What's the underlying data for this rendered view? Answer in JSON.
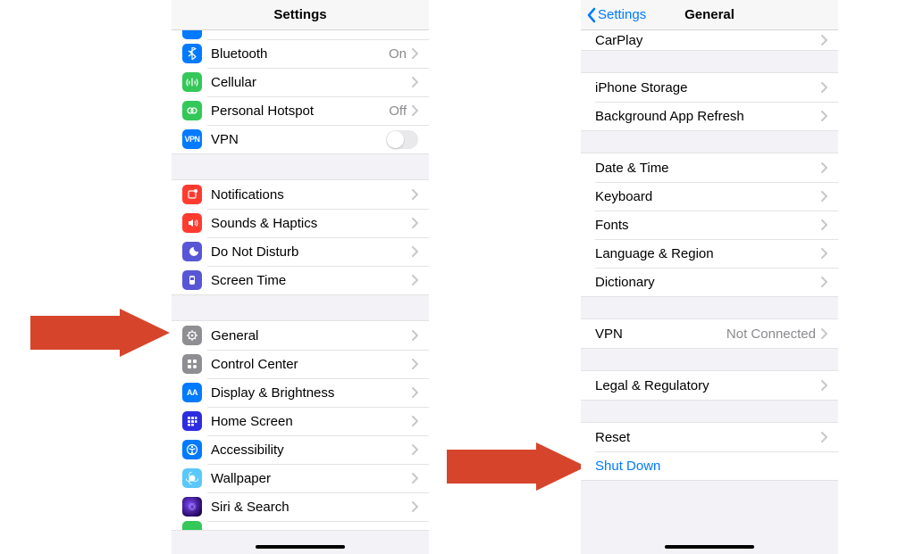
{
  "left": {
    "title": "Settings",
    "group0": {
      "bluetooth": {
        "label": "Bluetooth",
        "detail": "On"
      },
      "cellular": {
        "label": "Cellular"
      },
      "hotspot": {
        "label": "Personal Hotspot",
        "detail": "Off"
      },
      "vpn": {
        "label": "VPN"
      }
    },
    "group1": {
      "notifications": {
        "label": "Notifications"
      },
      "sounds": {
        "label": "Sounds & Haptics"
      },
      "dnd": {
        "label": "Do Not Disturb"
      },
      "screentime": {
        "label": "Screen Time"
      }
    },
    "group2": {
      "general": {
        "label": "General"
      },
      "controlcenter": {
        "label": "Control Center"
      },
      "display": {
        "label": "Display & Brightness"
      },
      "homescreen": {
        "label": "Home Screen"
      },
      "accessibility": {
        "label": "Accessibility"
      },
      "wallpaper": {
        "label": "Wallpaper"
      },
      "siri": {
        "label": "Siri & Search"
      }
    }
  },
  "right": {
    "back": "Settings",
    "title": "General",
    "carplay": {
      "label": "CarPlay"
    },
    "storage": {
      "label": "iPhone Storage"
    },
    "bgrefresh": {
      "label": "Background App Refresh"
    },
    "datetime": {
      "label": "Date & Time"
    },
    "keyboard": {
      "label": "Keyboard"
    },
    "fonts": {
      "label": "Fonts"
    },
    "language": {
      "label": "Language & Region"
    },
    "dictionary": {
      "label": "Dictionary"
    },
    "vpn": {
      "label": "VPN",
      "detail": "Not Connected"
    },
    "legal": {
      "label": "Legal & Regulatory"
    },
    "reset": {
      "label": "Reset"
    },
    "shutdown": {
      "label": "Shut Down"
    }
  }
}
